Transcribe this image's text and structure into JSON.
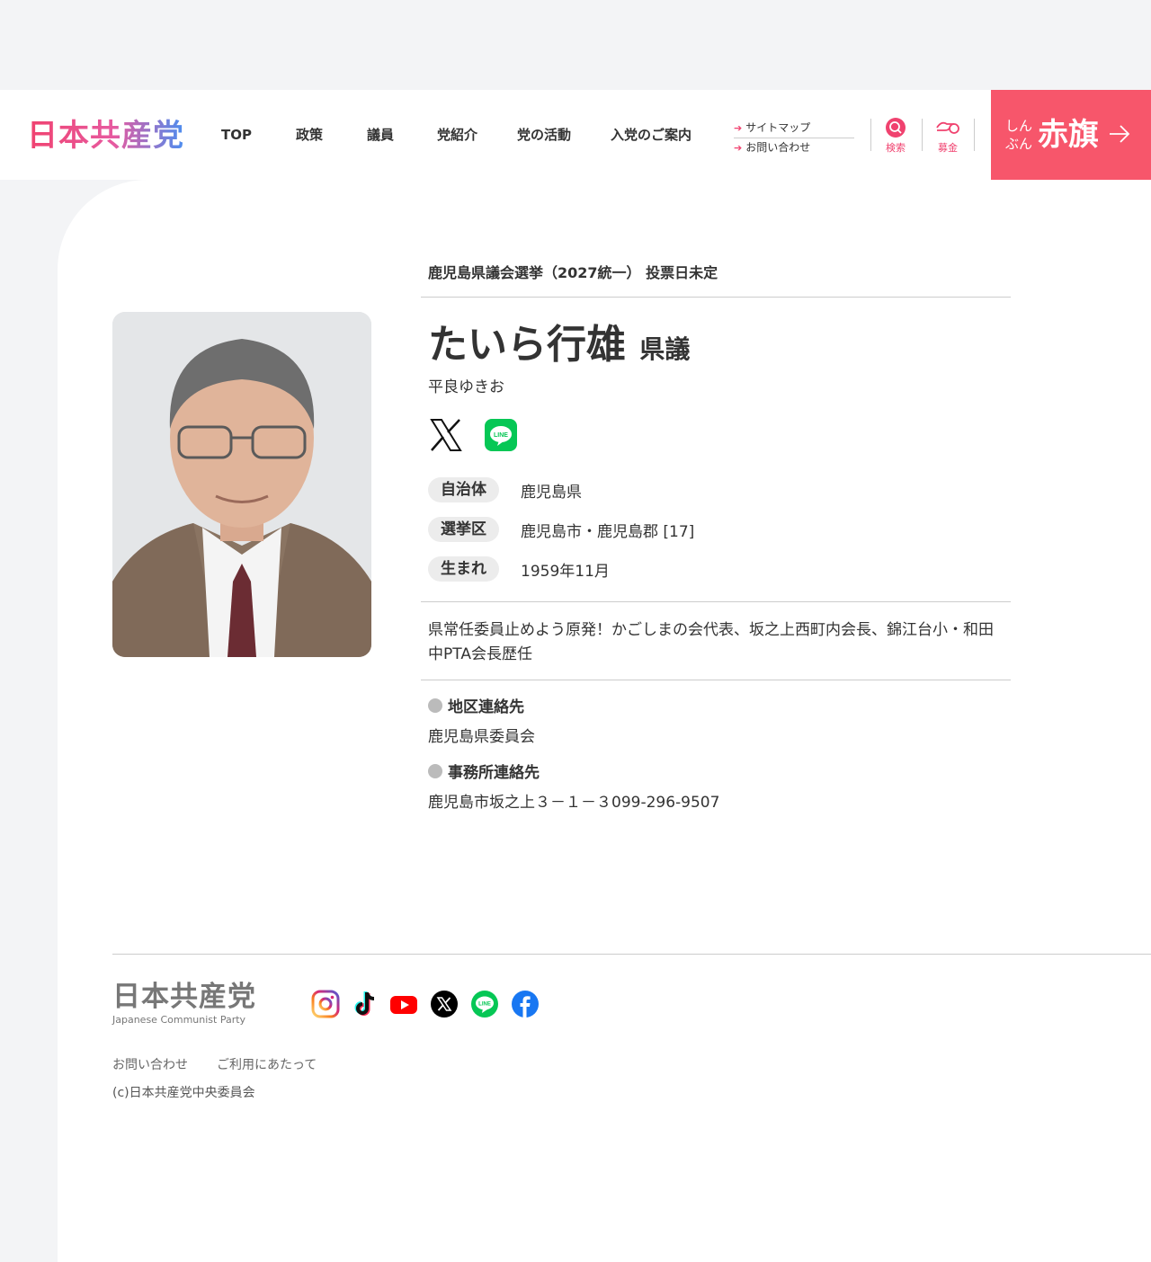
{
  "header": {
    "logo": "日本共産党",
    "nav": [
      "TOP",
      "政策",
      "議員",
      "党紹介",
      "党の活動",
      "入党のご案内"
    ],
    "sublinks": [
      "サイトマップ",
      "お問い合わせ"
    ],
    "search_label": "検索",
    "donate_label": "募金",
    "akahata_small": "しんぶん",
    "akahata_big": "赤旗"
  },
  "profile": {
    "election": "鹿児島県議会選挙（2027統一） 投票日未定",
    "name": "たいら行雄",
    "title": "県議",
    "kana": "平良ゆきお",
    "sns_icons": [
      "x-icon",
      "line-icon"
    ],
    "fields": [
      {
        "label": "自治体",
        "value": "鹿児島県"
      },
      {
        "label": "選挙区",
        "value": "鹿児島市・鹿児島郡 [17]"
      },
      {
        "label": "生まれ",
        "value": "1959年11月"
      }
    ],
    "bio": "県常任委員止めよう原発！かごしまの会代表、坂之上西町内会長、錦江台小・和田中PTA会長歴任",
    "contacts": [
      {
        "heading": "地区連絡先",
        "value": "鹿児島県委員会"
      },
      {
        "heading": "事務所連絡先",
        "value": "鹿児島市坂之上３－１－３099-296-9507"
      }
    ]
  },
  "footer": {
    "logo": "日本共産党",
    "logo_en": "Japanese Communist Party",
    "sns_icons": [
      "instagram-icon",
      "tiktok-icon",
      "youtube-icon",
      "x-icon",
      "line-icon",
      "facebook-icon"
    ],
    "links": [
      "お問い合わせ",
      "ご利用にあたって"
    ],
    "copyright": "(c)日本共産党中央委員会"
  },
  "colors": {
    "accent": "#f0426f",
    "akahata_bg": "#f7566b",
    "line_green": "#06c755",
    "facebook_blue": "#1877f2",
    "youtube_red": "#ff0000"
  }
}
